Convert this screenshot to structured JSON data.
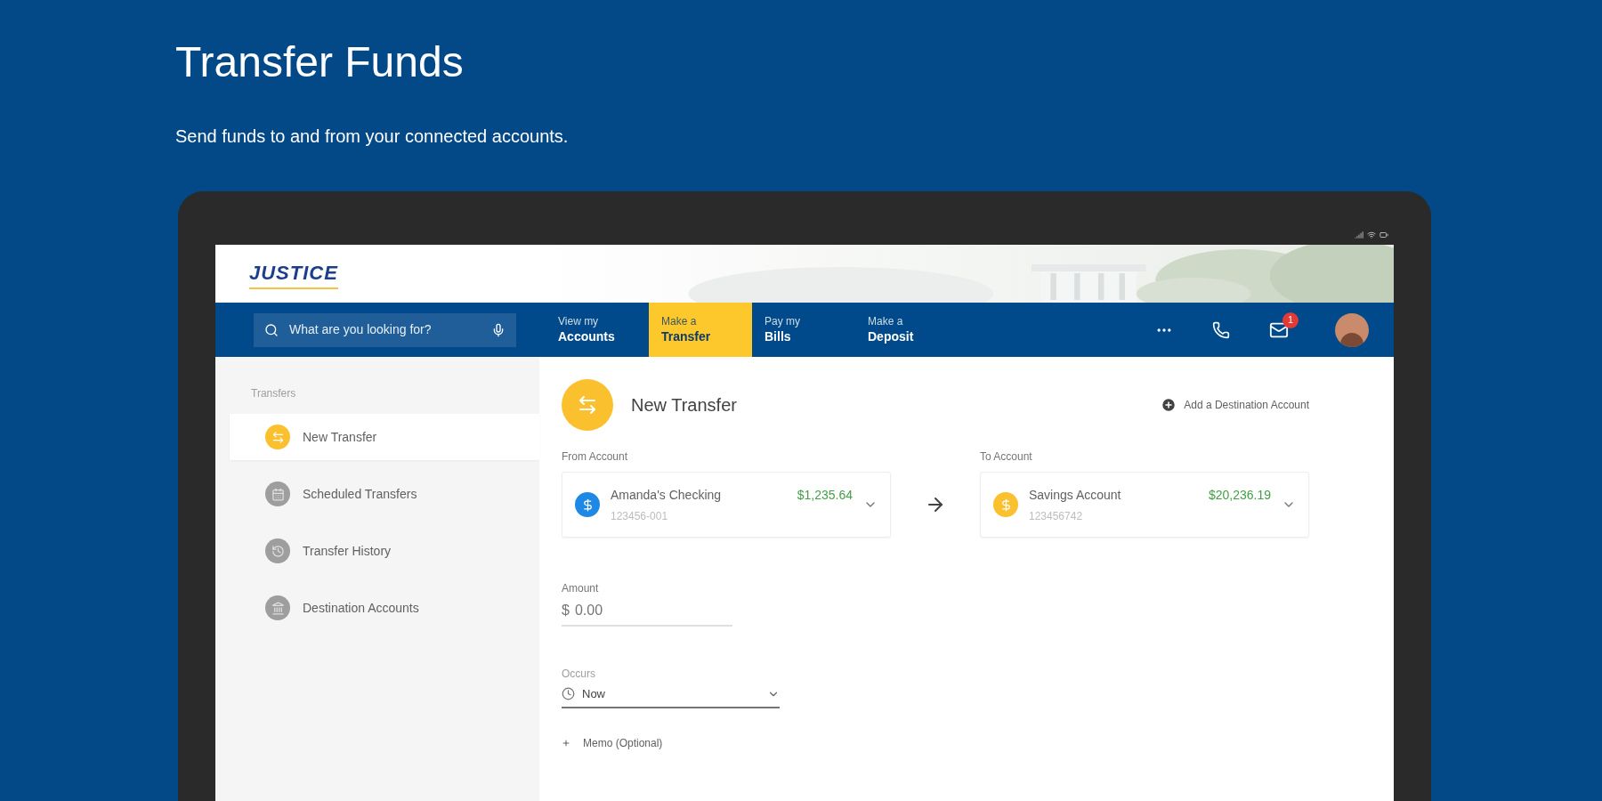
{
  "page": {
    "title": "Transfer Funds",
    "subtitle": "Send funds to and from your connected accounts."
  },
  "app": {
    "logo": "JUSTICE",
    "search": {
      "placeholder": "What are you looking for?"
    },
    "nav": [
      {
        "top": "View my",
        "bottom": "Accounts",
        "selected": false
      },
      {
        "top": "Make a",
        "bottom": "Transfer",
        "selected": true
      },
      {
        "top": "Pay my",
        "bottom": "Bills",
        "selected": false
      },
      {
        "top": "Make a",
        "bottom": "Deposit",
        "selected": false
      }
    ],
    "messages_badge": "1",
    "sidebar": {
      "heading": "Transfers",
      "items": [
        {
          "label": "New Transfer",
          "selected": true,
          "kind": "transfer"
        },
        {
          "label": "Scheduled Transfers",
          "selected": false,
          "kind": "calendar"
        },
        {
          "label": "Transfer History",
          "selected": false,
          "kind": "history"
        },
        {
          "label": "Destination Accounts",
          "selected": false,
          "kind": "accounts"
        }
      ]
    },
    "form": {
      "title": "New Transfer",
      "add_link": "Add a Destination Account",
      "from": {
        "label": "From Account",
        "name": "Amanda's Checking",
        "number": "123456-001",
        "balance": "$1,235.64",
        "color": "#1e88e5"
      },
      "to": {
        "label": "To Account",
        "name": "Savings Account",
        "number": "123456742",
        "balance": "$20,236.19",
        "color": "#fbc02d"
      },
      "amount": {
        "label": "Amount",
        "currency": "$",
        "value": "0.00"
      },
      "occurs": {
        "label": "Occurs",
        "value": "Now"
      },
      "memo": {
        "label": "Memo (Optional)"
      }
    }
  }
}
